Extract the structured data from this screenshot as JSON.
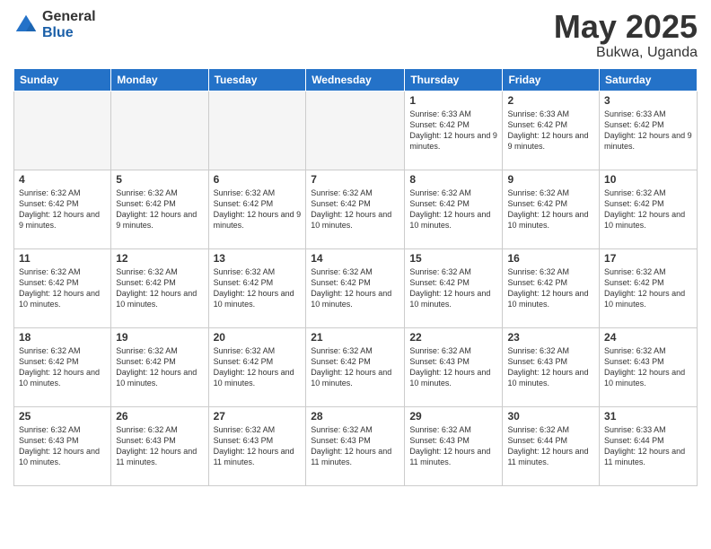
{
  "logo": {
    "general": "General",
    "blue": "Blue"
  },
  "header": {
    "month": "May 2025",
    "location": "Bukwa, Uganda"
  },
  "weekdays": [
    "Sunday",
    "Monday",
    "Tuesday",
    "Wednesday",
    "Thursday",
    "Friday",
    "Saturday"
  ],
  "weeks": [
    [
      {
        "day": "",
        "info": ""
      },
      {
        "day": "",
        "info": ""
      },
      {
        "day": "",
        "info": ""
      },
      {
        "day": "",
        "info": ""
      },
      {
        "day": "1",
        "info": "Sunrise: 6:33 AM\nSunset: 6:42 PM\nDaylight: 12 hours\nand 9 minutes."
      },
      {
        "day": "2",
        "info": "Sunrise: 6:33 AM\nSunset: 6:42 PM\nDaylight: 12 hours\nand 9 minutes."
      },
      {
        "day": "3",
        "info": "Sunrise: 6:33 AM\nSunset: 6:42 PM\nDaylight: 12 hours\nand 9 minutes."
      }
    ],
    [
      {
        "day": "4",
        "info": "Sunrise: 6:32 AM\nSunset: 6:42 PM\nDaylight: 12 hours\nand 9 minutes."
      },
      {
        "day": "5",
        "info": "Sunrise: 6:32 AM\nSunset: 6:42 PM\nDaylight: 12 hours\nand 9 minutes."
      },
      {
        "day": "6",
        "info": "Sunrise: 6:32 AM\nSunset: 6:42 PM\nDaylight: 12 hours\nand 9 minutes."
      },
      {
        "day": "7",
        "info": "Sunrise: 6:32 AM\nSunset: 6:42 PM\nDaylight: 12 hours\nand 10 minutes."
      },
      {
        "day": "8",
        "info": "Sunrise: 6:32 AM\nSunset: 6:42 PM\nDaylight: 12 hours\nand 10 minutes."
      },
      {
        "day": "9",
        "info": "Sunrise: 6:32 AM\nSunset: 6:42 PM\nDaylight: 12 hours\nand 10 minutes."
      },
      {
        "day": "10",
        "info": "Sunrise: 6:32 AM\nSunset: 6:42 PM\nDaylight: 12 hours\nand 10 minutes."
      }
    ],
    [
      {
        "day": "11",
        "info": "Sunrise: 6:32 AM\nSunset: 6:42 PM\nDaylight: 12 hours\nand 10 minutes."
      },
      {
        "day": "12",
        "info": "Sunrise: 6:32 AM\nSunset: 6:42 PM\nDaylight: 12 hours\nand 10 minutes."
      },
      {
        "day": "13",
        "info": "Sunrise: 6:32 AM\nSunset: 6:42 PM\nDaylight: 12 hours\nand 10 minutes."
      },
      {
        "day": "14",
        "info": "Sunrise: 6:32 AM\nSunset: 6:42 PM\nDaylight: 12 hours\nand 10 minutes."
      },
      {
        "day": "15",
        "info": "Sunrise: 6:32 AM\nSunset: 6:42 PM\nDaylight: 12 hours\nand 10 minutes."
      },
      {
        "day": "16",
        "info": "Sunrise: 6:32 AM\nSunset: 6:42 PM\nDaylight: 12 hours\nand 10 minutes."
      },
      {
        "day": "17",
        "info": "Sunrise: 6:32 AM\nSunset: 6:42 PM\nDaylight: 12 hours\nand 10 minutes."
      }
    ],
    [
      {
        "day": "18",
        "info": "Sunrise: 6:32 AM\nSunset: 6:42 PM\nDaylight: 12 hours\nand 10 minutes."
      },
      {
        "day": "19",
        "info": "Sunrise: 6:32 AM\nSunset: 6:42 PM\nDaylight: 12 hours\nand 10 minutes."
      },
      {
        "day": "20",
        "info": "Sunrise: 6:32 AM\nSunset: 6:42 PM\nDaylight: 12 hours\nand 10 minutes."
      },
      {
        "day": "21",
        "info": "Sunrise: 6:32 AM\nSunset: 6:42 PM\nDaylight: 12 hours\nand 10 minutes."
      },
      {
        "day": "22",
        "info": "Sunrise: 6:32 AM\nSunset: 6:43 PM\nDaylight: 12 hours\nand 10 minutes."
      },
      {
        "day": "23",
        "info": "Sunrise: 6:32 AM\nSunset: 6:43 PM\nDaylight: 12 hours\nand 10 minutes."
      },
      {
        "day": "24",
        "info": "Sunrise: 6:32 AM\nSunset: 6:43 PM\nDaylight: 12 hours\nand 10 minutes."
      }
    ],
    [
      {
        "day": "25",
        "info": "Sunrise: 6:32 AM\nSunset: 6:43 PM\nDaylight: 12 hours\nand 10 minutes."
      },
      {
        "day": "26",
        "info": "Sunrise: 6:32 AM\nSunset: 6:43 PM\nDaylight: 12 hours\nand 11 minutes."
      },
      {
        "day": "27",
        "info": "Sunrise: 6:32 AM\nSunset: 6:43 PM\nDaylight: 12 hours\nand 11 minutes."
      },
      {
        "day": "28",
        "info": "Sunrise: 6:32 AM\nSunset: 6:43 PM\nDaylight: 12 hours\nand 11 minutes."
      },
      {
        "day": "29",
        "info": "Sunrise: 6:32 AM\nSunset: 6:43 PM\nDaylight: 12 hours\nand 11 minutes."
      },
      {
        "day": "30",
        "info": "Sunrise: 6:32 AM\nSunset: 6:44 PM\nDaylight: 12 hours\nand 11 minutes."
      },
      {
        "day": "31",
        "info": "Sunrise: 6:33 AM\nSunset: 6:44 PM\nDaylight: 12 hours\nand 11 minutes."
      }
    ]
  ]
}
